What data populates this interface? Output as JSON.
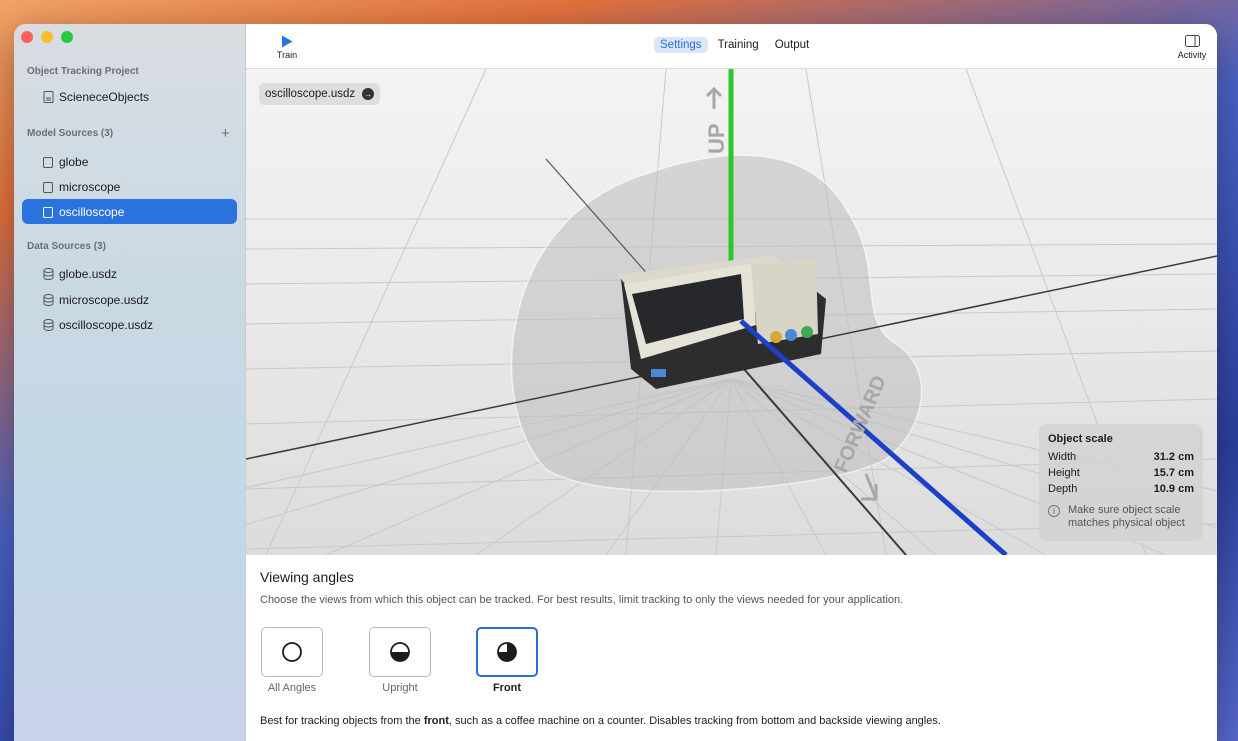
{
  "sidebar": {
    "project_header": "Object Tracking Project",
    "project_item": "ScieneceObjects",
    "model_sources_header": "Model Sources (3)",
    "add_symbol": "+",
    "model_sources": [
      "globe",
      "microscope",
      "oscilloscope"
    ],
    "data_sources_header": "Data Sources (3)",
    "data_sources": [
      "globe.usdz",
      "microscope.usdz",
      "oscilloscope.usdz"
    ]
  },
  "toolbar": {
    "train_label": "Train",
    "tabs": [
      "Settings",
      "Training",
      "Output"
    ],
    "active_tab": "Settings",
    "activity_label": "Activity"
  },
  "viewport": {
    "file_chip": "oscilloscope.usdz",
    "axis_up": "UP",
    "axis_forward": "FORWARD"
  },
  "object_scale": {
    "title": "Object scale",
    "rows": [
      {
        "label": "Width",
        "value": "31.2 cm"
      },
      {
        "label": "Height",
        "value": "15.7 cm"
      },
      {
        "label": "Depth",
        "value": "10.9 cm"
      }
    ],
    "note_line1": "Make sure object scale",
    "note_line2": "matches physical object"
  },
  "viewing_angles": {
    "title": "Viewing angles",
    "description": "Choose the views from which this object can be tracked. For best results, limit tracking to only the views needed for your application.",
    "options": [
      "All Angles",
      "Upright",
      "Front"
    ],
    "selected": "Front",
    "note_prefix": "Best for tracking objects from the ",
    "note_bold": "front",
    "note_suffix": ", such as a coffee machine on a counter. Disables tracking from bottom and backside viewing angles."
  },
  "colors": {
    "accent": "#2a73df",
    "up_axis": "#2fc52f",
    "forward_axis": "#1d3fc9"
  }
}
